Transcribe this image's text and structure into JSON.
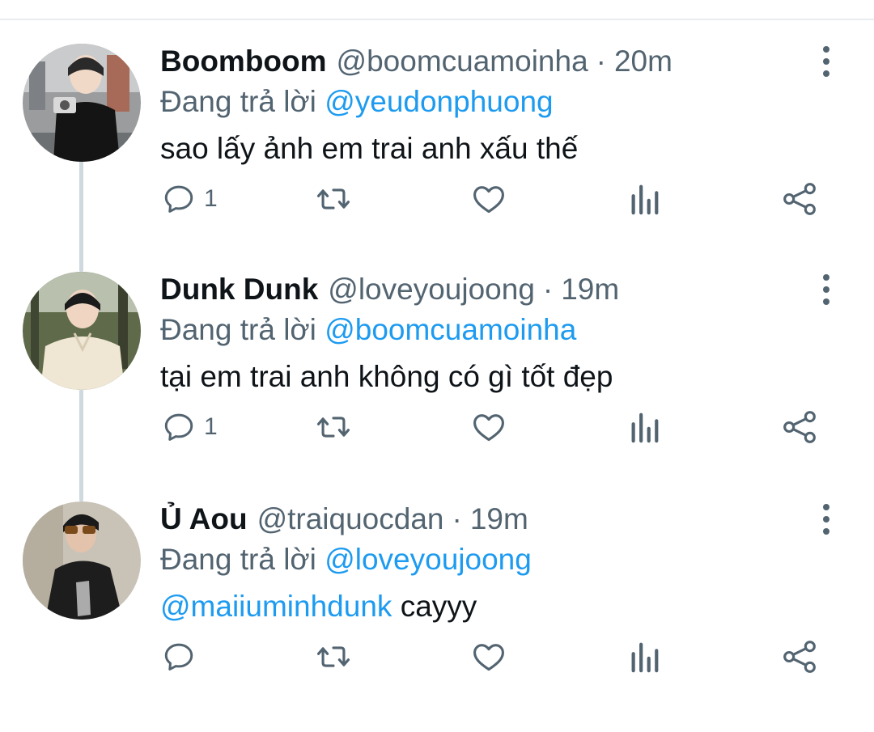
{
  "tweets": [
    {
      "name": "Boomboom",
      "handle": "@boomcuamoinha",
      "separator": "·",
      "time": "20m",
      "reply_prefix": "Đang trả lời",
      "reply_to": "@yeudonphuong",
      "body": "sao lấy ảnh em trai anh xấu thế",
      "reply_count": "1"
    },
    {
      "name": "Dunk Dunk",
      "handle": "@loveyoujoong",
      "separator": "·",
      "time": "19m",
      "reply_prefix": "Đang trả lời",
      "reply_to": "@boomcuamoinha",
      "body": "tại em trai anh không có gì tốt đẹp",
      "reply_count": "1"
    },
    {
      "name": "Ủ Aou",
      "handle": "@traiquocdan",
      "separator": "·",
      "time": "19m",
      "reply_prefix": "Đang trả lời",
      "reply_to": "@loveyoujoong",
      "body_mention": "@maiiuminhdunk",
      "body": " cayyy",
      "reply_count": ""
    }
  ],
  "icons": [
    "reply-icon",
    "retweet-icon",
    "like-icon",
    "analytics-icon",
    "share-icon",
    "more-options-icon"
  ],
  "colors": {
    "accent": "#1d9bf0",
    "secondary_text": "#536471",
    "thread_line": "#cfd9de"
  }
}
